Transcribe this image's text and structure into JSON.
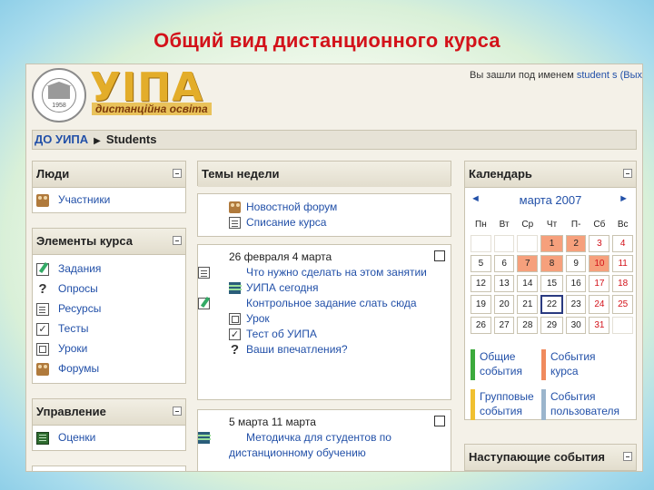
{
  "slide_title": "Общий вид дистанционного курса",
  "header": {
    "logo_text": "УІПА",
    "logo_subtitle": "дистанційна освіта",
    "seal_year": "1958",
    "user_prefix": "Вы зашли под именем",
    "user_name": "student s",
    "logout": "(Выход)"
  },
  "breadcrumb": {
    "home": "ДО УИПА",
    "current": "Students"
  },
  "people": {
    "title": "Люди",
    "items": [
      {
        "label": "Участники",
        "icon": "participants-icon"
      }
    ]
  },
  "course_elements": {
    "title": "Элементы курса",
    "items": [
      {
        "label": "Задания",
        "icon": "assignment-icon"
      },
      {
        "label": "Опросы",
        "icon": "question-icon"
      },
      {
        "label": "Ресурсы",
        "icon": "document-icon"
      },
      {
        "label": "Тесты",
        "icon": "checkmark-icon"
      },
      {
        "label": "Уроки",
        "icon": "lesson-icon"
      },
      {
        "label": "Форумы",
        "icon": "forum-icon"
      }
    ]
  },
  "management": {
    "title": "Управление",
    "items": [
      {
        "label": "Оценки",
        "icon": "grades-icon"
      }
    ]
  },
  "topics": {
    "title": "Темы недели",
    "section0": {
      "items": [
        {
          "label": "Новостной форум"
        },
        {
          "label": "Списание курса"
        }
      ]
    },
    "section1": {
      "date": "26 февраля 4 марта",
      "items": [
        {
          "label": "Что нужно сделать на этом занятии"
        },
        {
          "label": "УИПА сегодня"
        },
        {
          "label": "Контрольное задание слать сюда"
        },
        {
          "label": "Урок"
        },
        {
          "label": "Тест об УИПА"
        },
        {
          "label": "Ваши впечатления?"
        }
      ]
    },
    "section2": {
      "date": "5 марта 11 марта",
      "items": [
        {
          "label": "Методичка для студентов по дистанционному обучению"
        }
      ]
    }
  },
  "calendar": {
    "title": "Календарь",
    "prev": "◄",
    "next": "►",
    "month": "марта 2007",
    "weekdays": [
      "Пн",
      "Вт",
      "Ср",
      "Чт",
      "П-",
      "Сб",
      "Вс"
    ],
    "weeks": [
      [
        "",
        "",
        "",
        "1",
        "2",
        "3",
        "4"
      ],
      [
        "5",
        "6",
        "7",
        "8",
        "9",
        "10",
        "11"
      ],
      [
        "12",
        "13",
        "14",
        "15",
        "16",
        "17",
        "18"
      ],
      [
        "19",
        "20",
        "21",
        "22",
        "23",
        "24",
        "25"
      ],
      [
        "26",
        "27",
        "28",
        "29",
        "30",
        "31",
        ""
      ]
    ],
    "event_days": [
      "1",
      "2",
      "7",
      "8",
      "10"
    ],
    "today": "22",
    "legend": [
      {
        "label": "Общие события",
        "color": "#3caa3c"
      },
      {
        "label": "События курса",
        "color": "#f08a5d"
      },
      {
        "label": "Групповые события",
        "color": "#f0c030"
      },
      {
        "label": "События пользователя",
        "color": "#9bb5cc"
      }
    ]
  },
  "upcoming": {
    "title": "Наступающие события"
  }
}
